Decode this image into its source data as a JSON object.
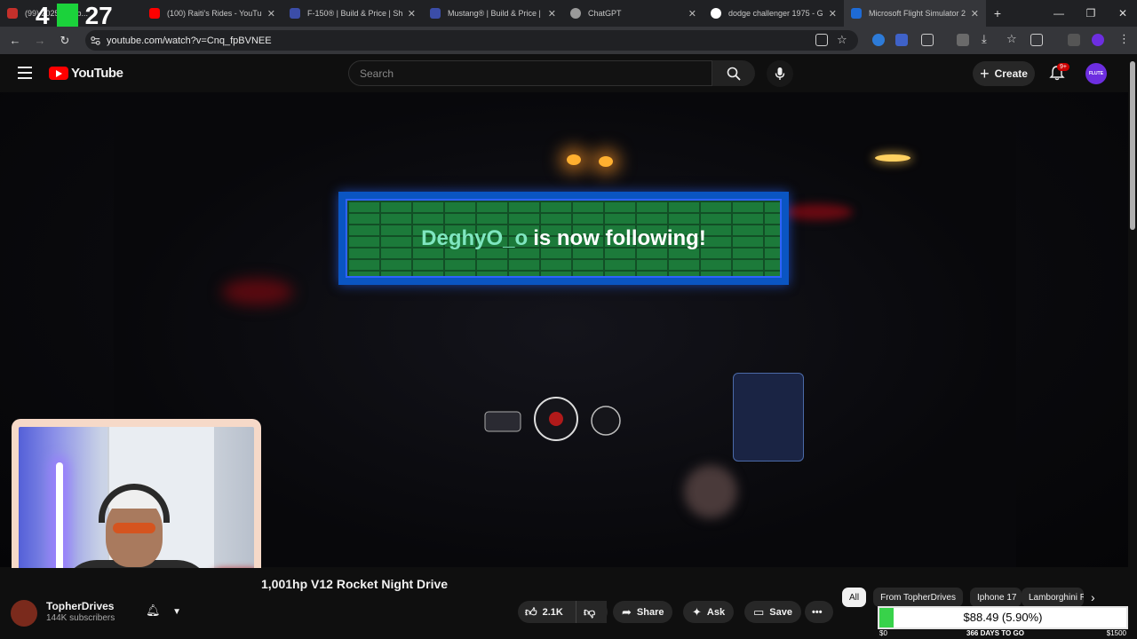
{
  "browser": {
    "tabs": [
      {
        "label": "(99) 2025 Lamb...",
        "color": "#c4302b"
      },
      {
        "label": "(100) Raiti's Rides - YouTub",
        "color": "#ff0000"
      },
      {
        "label": "F-150® | Build & Price | Sh",
        "color": "#3b4da8"
      },
      {
        "label": "Mustang® | Build & Price |",
        "color": "#3b4da8"
      },
      {
        "label": "ChatGPT",
        "color": "#9a9a9a"
      },
      {
        "label": "dodge challenger 1975 - G",
        "color": "#ffffff"
      },
      {
        "label": "Microsoft Flight Simulator 2",
        "color": "#1e6bd6"
      }
    ],
    "url": "youtube.com/watch?v=Cnq_fpBVNEE",
    "new_tab": "+",
    "win_min": "—",
    "win_max": "❐",
    "win_close": "✕"
  },
  "overlay": {
    "left": "4",
    "right": "27"
  },
  "youtube": {
    "logo_text": "YouTube",
    "search_placeholder": "Search",
    "create_label": "Create",
    "notif_count": "9+",
    "avatar_text": "FLUTE"
  },
  "stream_alert": {
    "who": "DeghyO_o",
    "message": "is now following!"
  },
  "video": {
    "title": "1,001hp V12 Rocket Night Drive",
    "channel": "TopherDrives",
    "subscribers": "144K subscribers",
    "likes": "2.1K",
    "share_label": "Share",
    "ask_label": "Ask",
    "save_label": "Save",
    "more_label": "•••"
  },
  "chips": [
    "All",
    "From TopherDrives",
    "Iphone 17",
    "Lamborghini Revuelto"
  ],
  "ticker": {
    "value": "$88.49 (5.90%)",
    "fill_percent": 5.9,
    "left": "$0",
    "mid": "366 DAYS TO GO",
    "right": "$1500"
  },
  "colors": {
    "alert_who": "#7fe6c0",
    "brick": "#1c7a3a",
    "alert_border": "#0a55c2",
    "ticker_fill": "#38d24a"
  }
}
